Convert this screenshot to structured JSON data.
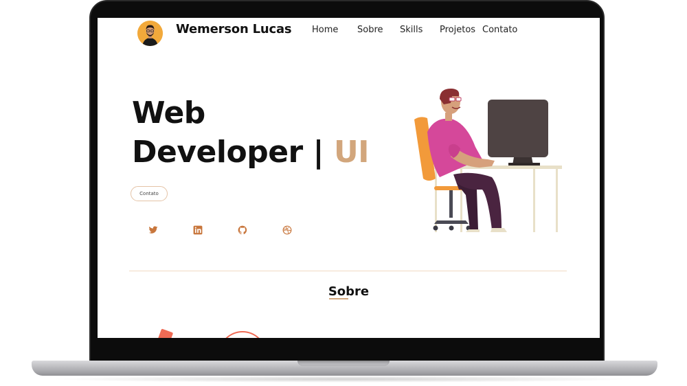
{
  "nav": {
    "brand": "Wemerson Lucas",
    "links": [
      "Home",
      "Sobre",
      "Skills",
      "Projetos",
      "Contato"
    ]
  },
  "hero": {
    "title_line1": "Web",
    "title_line2": "Developer |",
    "title_accent": "UI",
    "contact_button": "Contato",
    "social_icons": [
      "twitter-icon",
      "linkedin-icon",
      "github-icon",
      "dribbble-icon"
    ]
  },
  "about": {
    "title": "Sobre"
  },
  "colors": {
    "accent": "#d2a67c",
    "icon": "#c8763c",
    "avatar_bg": "#f2a93b",
    "shirt": "#d5489a",
    "chair": "#f29a3a"
  }
}
